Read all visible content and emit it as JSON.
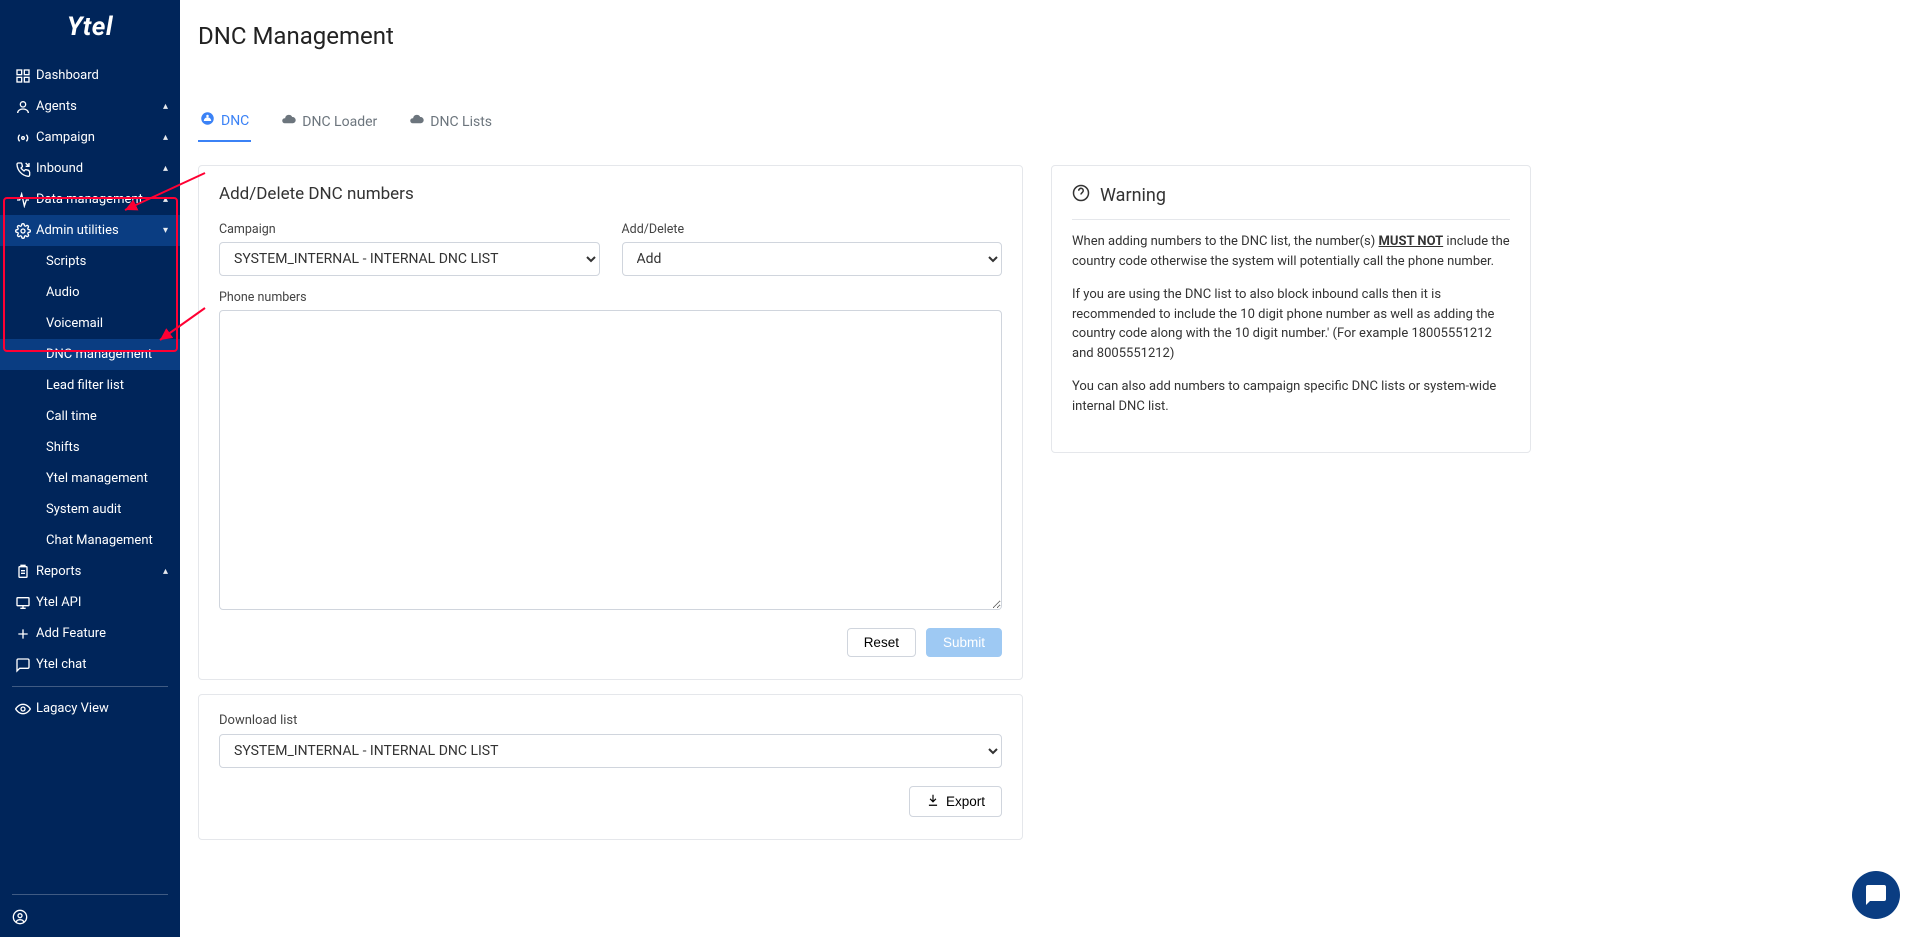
{
  "app": {
    "logo_text": "Ytel"
  },
  "sidebar": {
    "items": [
      {
        "label": "Dashboard",
        "icon": "grid"
      },
      {
        "label": "Agents",
        "icon": "user",
        "expandable": true,
        "caret": "▴"
      },
      {
        "label": "Campaign",
        "icon": "broadcast",
        "expandable": true,
        "caret": "▴"
      },
      {
        "label": "Inbound",
        "icon": "phone-in",
        "expandable": true,
        "caret": "▴"
      },
      {
        "label": "Data management",
        "icon": "activity",
        "expandable": true,
        "caret": "▴"
      },
      {
        "label": "Admin utilities",
        "icon": "gear",
        "expandable": true,
        "caret": "▾"
      }
    ],
    "admin_sub": [
      {
        "label": "Scripts"
      },
      {
        "label": "Audio"
      },
      {
        "label": "Voicemail"
      },
      {
        "label": "DNC management"
      },
      {
        "label": "Lead filter list"
      },
      {
        "label": "Call time"
      },
      {
        "label": "Shifts"
      },
      {
        "label": "Ytel management"
      },
      {
        "label": "System audit"
      },
      {
        "label": "Chat Management"
      }
    ],
    "tail": [
      {
        "label": "Reports",
        "icon": "clipboard",
        "expandable": true,
        "caret": "▴"
      },
      {
        "label": "Ytel API",
        "icon": "monitor"
      },
      {
        "label": "Add Feature",
        "icon": "plus"
      },
      {
        "label": "Ytel chat",
        "icon": "chat"
      }
    ],
    "legacy": {
      "label": "Lagacy View",
      "icon": "eye"
    }
  },
  "page": {
    "title": "DNC Management"
  },
  "tabs": [
    {
      "label": "DNC",
      "icon": "dashboard",
      "active": true
    },
    {
      "label": "DNC Loader",
      "icon": "cloud"
    },
    {
      "label": "DNC Lists",
      "icon": "cloud"
    }
  ],
  "form": {
    "panel_title": "Add/Delete DNC numbers",
    "campaign_label": "Campaign",
    "campaign_value": "SYSTEM_INTERNAL - INTERNAL DNC LIST",
    "add_delete_label": "Add/Delete",
    "add_delete_value": "Add",
    "phone_label": "Phone numbers",
    "reset": "Reset",
    "submit": "Submit"
  },
  "download": {
    "label": "Download list",
    "value": "SYSTEM_INTERNAL - INTERNAL DNC LIST",
    "export": "Export"
  },
  "warning": {
    "title": "Warning",
    "p1a": "When adding numbers to the DNC list, the number(s) ",
    "p1b": "MUST NOT",
    "p1c": " include the country code otherwise the system will potentially call the phone number.",
    "p2": "If you are using the DNC list to also block inbound calls then it is recommended to include the 10 digit phone number as well as adding the country code along with the 10 digit number.' (For example 18005551212 and 8005551212)",
    "p3": "You can also add numbers to campaign specific DNC lists or system-wide internal DNC list."
  }
}
